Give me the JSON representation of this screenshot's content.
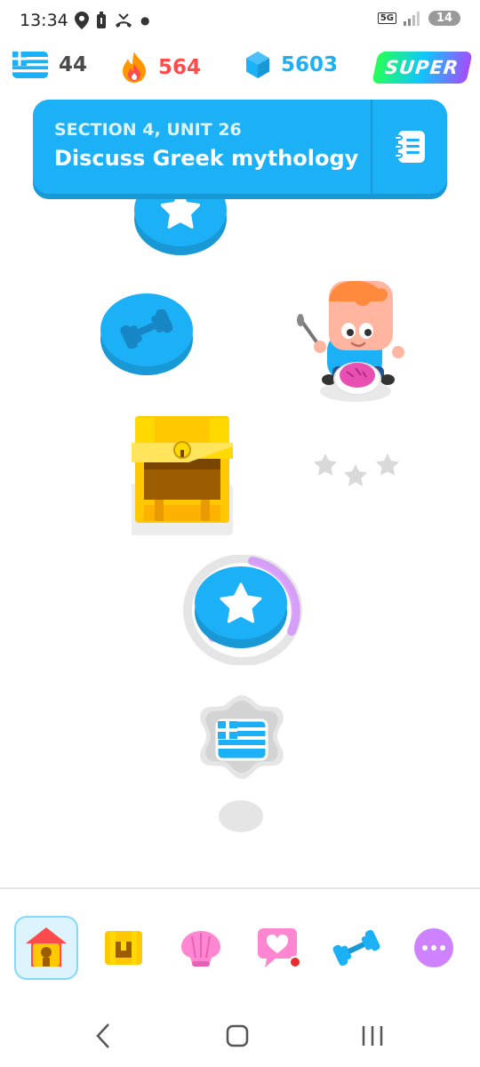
{
  "status_bar": {
    "time": "13:34",
    "network": "5G",
    "battery": "14"
  },
  "top_stats": {
    "course_flag_icon": "greece-flag-icon",
    "course_count": "44",
    "streak": "564",
    "gems": "5603",
    "super_label": "SUPER"
  },
  "unit_banner": {
    "section": "SECTION 4, UNIT 26",
    "title": "Discuss Greek mythology"
  },
  "path": {
    "nodes": [
      {
        "type": "star-lesson",
        "state": "locked-partial"
      },
      {
        "type": "practice-dumbbell",
        "state": "available"
      },
      {
        "type": "treasure-chest",
        "state": "available"
      },
      {
        "type": "star-lesson",
        "state": "current"
      },
      {
        "type": "unit-flag",
        "state": "locked"
      }
    ]
  },
  "bottom_nav": {
    "items": [
      {
        "name": "learn",
        "icon": "home-icon",
        "active": true
      },
      {
        "name": "chest",
        "icon": "treasure-chest-icon",
        "active": false
      },
      {
        "name": "leagues",
        "icon": "shell-icon",
        "active": false
      },
      {
        "name": "quests",
        "icon": "heart-message-icon",
        "active": false
      },
      {
        "name": "practice",
        "icon": "dumbbell-icon",
        "active": false
      },
      {
        "name": "more",
        "icon": "more-icon",
        "active": false
      }
    ]
  },
  "colors": {
    "primary_blue": "#1cb0f6",
    "blue_shadow": "#1899d6",
    "streak_red": "#ff4b4b",
    "gold": "#ffc800",
    "gray": "#e5e5e5"
  }
}
